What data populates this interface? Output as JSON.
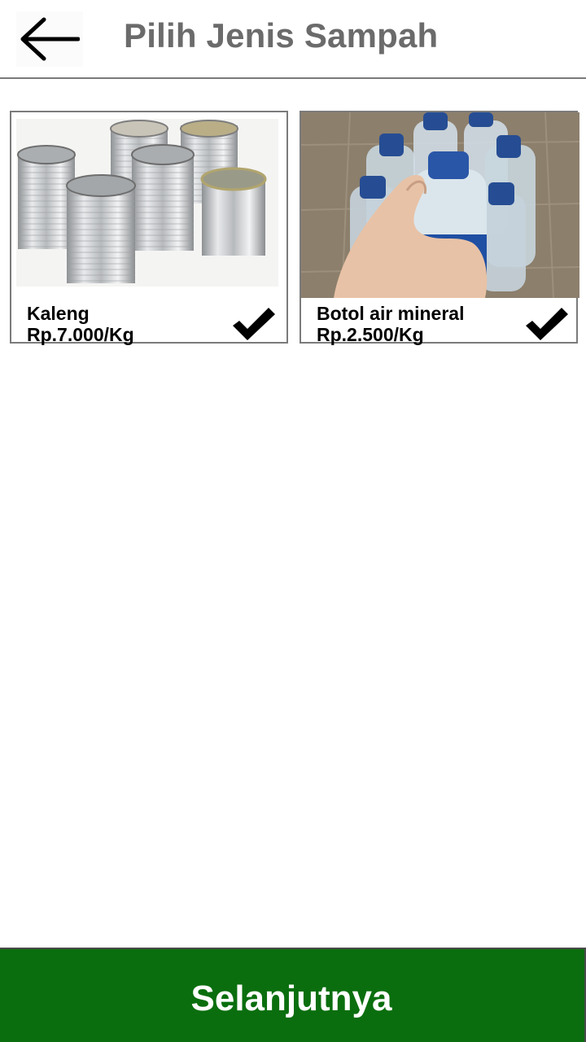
{
  "header": {
    "title": "Pilih Jenis Sampah",
    "back_icon": "arrow-left-icon"
  },
  "items": [
    {
      "name": "Kaleng",
      "price": "Rp.7.000/Kg",
      "image": "tin-cans-photo",
      "selected": true,
      "check_icon": "checkmark-icon"
    },
    {
      "name": "Botol air mineral",
      "price": "Rp.2.500/Kg",
      "image": "water-bottles-photo",
      "selected": true,
      "check_icon": "checkmark-icon"
    }
  ],
  "footer": {
    "next_label": "Selanjutnya"
  },
  "colors": {
    "primary": "#0a6e0e",
    "title_text": "#6b6b6b",
    "border": "#7b7b7b"
  }
}
